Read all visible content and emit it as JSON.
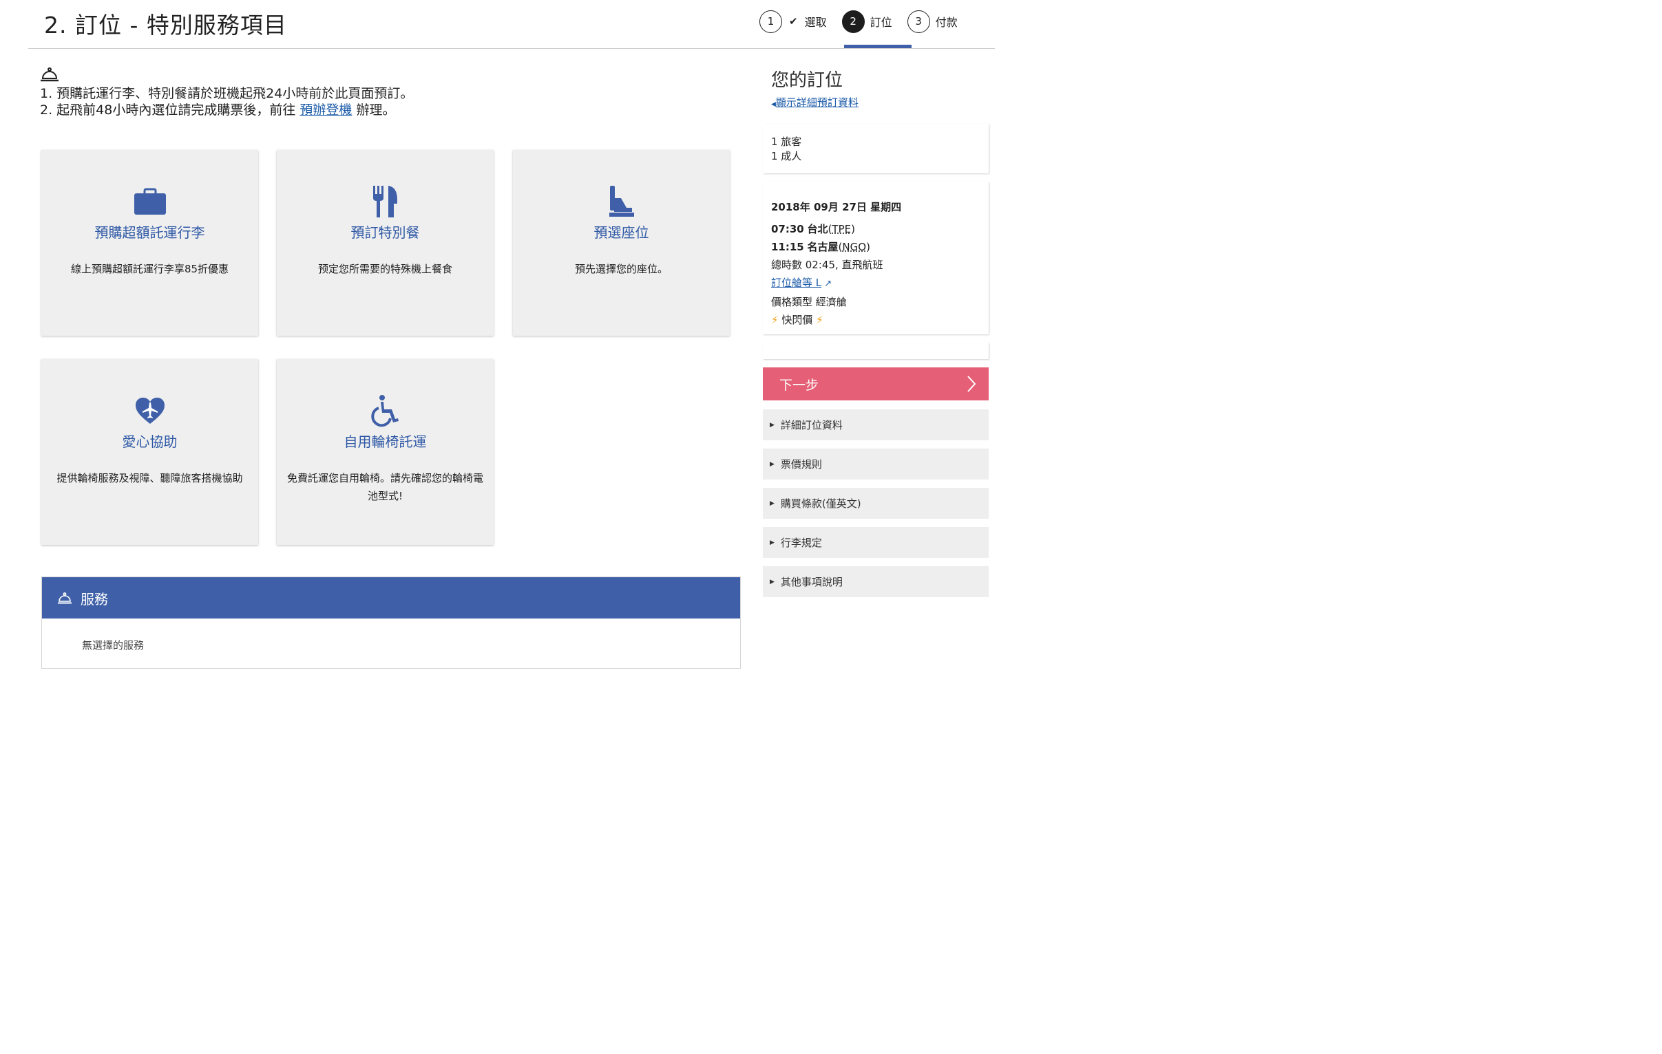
{
  "header": {
    "title": "2. 訂位 - 特別服務項目",
    "steps": [
      {
        "num": "1",
        "label": "選取",
        "done": true
      },
      {
        "num": "2",
        "label": "訂位",
        "active": true
      },
      {
        "num": "3",
        "label": "付款"
      }
    ]
  },
  "notice": {
    "line1": "1. 預購託運行李、特別餐請於班機起飛24小時前於此頁面預訂。",
    "line2_prefix": "2. 起飛前48小時內選位請完成購票後，前往 ",
    "line2_link": "預辦登機",
    "line2_suffix": " 辦理。"
  },
  "cards": [
    {
      "title": "預購超額託運行李",
      "desc": "線上預購超額託運行李享85折優惠",
      "icon": "suitcase-icon"
    },
    {
      "title": "預訂特別餐",
      "desc": "预定您所需要的特殊機上餐食",
      "icon": "cutlery-icon"
    },
    {
      "title": "預選座位",
      "desc": "預先選擇您的座位。",
      "icon": "seat-icon"
    },
    {
      "title": "愛心協助",
      "desc": "提供輪椅服務及視障、聽障旅客搭機協助",
      "icon": "heart-plane-icon"
    },
    {
      "title": "自用輪椅託運",
      "desc": "免費託運您自用輪椅。請先確認您的輪椅電池型式!",
      "icon": "wheelchair-icon"
    }
  ],
  "services": {
    "title": "服務",
    "empty": "無選擇的服務"
  },
  "sidebar": {
    "title": "您的訂位",
    "details_link": "顯示詳細預訂資料",
    "passengers": "1 旅客",
    "adults": "1 成人",
    "date": "2018年 09月 27日 星期四",
    "dep_time": "07:30",
    "dep_city": "台北",
    "dep_code": "TPE",
    "arr_time": "11:15",
    "arr_city": "名古屋",
    "arr_code": "NGO",
    "duration": "總時數 02:45, 直飛航班",
    "class_link": "訂位艙等 L",
    "fare_type": "價格類型 經濟艙",
    "fare_name": "快閃價",
    "next_button": "下一步",
    "accordions": [
      "詳細訂位資料",
      "票價規則",
      "購買條款(僅英文)",
      "行李規定",
      "其他事項說明"
    ]
  },
  "colors": {
    "primary": "#3f60a8",
    "link": "#1a5aa8",
    "next": "#e55f76",
    "flash": "#f3a21a"
  }
}
